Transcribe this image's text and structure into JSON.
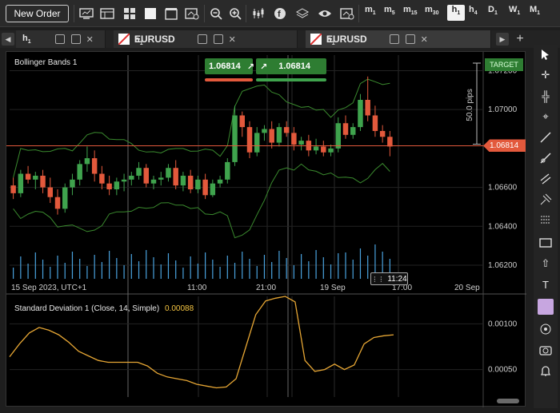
{
  "toolbar": {
    "new_order": "New Order",
    "timeframes": [
      {
        "base": "m",
        "sub": "1"
      },
      {
        "base": "m",
        "sub": "5"
      },
      {
        "base": "m",
        "sub": "15"
      },
      {
        "base": "m",
        "sub": "30"
      },
      {
        "base": "h",
        "sub": "1"
      },
      {
        "base": "h",
        "sub": "4"
      },
      {
        "base": "D",
        "sub": "1"
      },
      {
        "base": "W",
        "sub": "1"
      },
      {
        "base": "M",
        "sub": "1"
      }
    ],
    "active_timeframe": "h1"
  },
  "tabs": [
    {
      "timeframe_base": "h",
      "timeframe_sub": "1",
      "symbol": ""
    },
    {
      "timeframe_base": "",
      "timeframe_sub": "",
      "symbol": "EURUSD"
    },
    {
      "timeframe_base": "",
      "timeframe_sub": "",
      "symbol": "EURUSD"
    }
  ],
  "chart": {
    "main_title": "Bollinger Bands 1",
    "sell_price": "1.06814",
    "buy_price": "1.06814",
    "current_price": "1.06814",
    "target_label": "TARGET",
    "pips_label": "50.0 pips",
    "y_ticks": [
      "1.07200",
      "1.07000",
      "1.06600",
      "1.06400",
      "1.06200"
    ],
    "x_ticks": [
      "15 Sep 2023, UTC+1",
      "11:00",
      "21:00",
      "19 Sep",
      "17:00",
      "20 Sep"
    ],
    "crosshair_time": "11:24",
    "sub_title": "Standard Deviation 1 (Close, 14, Simple)",
    "sub_value": "0.00088",
    "sub_y_ticks": [
      "0.00100",
      "0.00050"
    ],
    "colors": {
      "bull": "#3fa34d",
      "bear": "#e3593c",
      "band": "#3a8a2e",
      "price_line": "#e3593c",
      "stddev": "#e6a634",
      "volume": "#4aa3df"
    }
  },
  "chart_data": [
    {
      "type": "candlestick",
      "title": "Bollinger Bands 1",
      "ylim": [
        1.0613,
        1.0728
      ],
      "y_ticks": [
        1.072,
        1.07,
        1.066,
        1.064,
        1.062
      ],
      "current_price": 1.06814,
      "series": [
        {
          "name": "candles",
          "ohlc": [
            [
              1.0661,
              1.0665,
              1.0654,
              1.0657
            ],
            [
              1.0657,
              1.0669,
              1.0655,
              1.0667
            ],
            [
              1.0667,
              1.0671,
              1.0662,
              1.0664
            ],
            [
              1.0664,
              1.0668,
              1.0659,
              1.0666
            ],
            [
              1.0666,
              1.0669,
              1.0657,
              1.066
            ],
            [
              1.066,
              1.0665,
              1.0652,
              1.0655
            ],
            [
              1.0655,
              1.0659,
              1.0646,
              1.0649
            ],
            [
              1.0649,
              1.0662,
              1.0647,
              1.066
            ],
            [
              1.066,
              1.0667,
              1.0656,
              1.0664
            ],
            [
              1.0664,
              1.0674,
              1.0661,
              1.0672
            ],
            [
              1.0672,
              1.0681,
              1.0668,
              1.0675
            ],
            [
              1.0675,
              1.0679,
              1.0663,
              1.0667
            ],
            [
              1.0667,
              1.0671,
              1.0659,
              1.0662
            ],
            [
              1.0662,
              1.0666,
              1.0656,
              1.0659
            ],
            [
              1.0659,
              1.0665,
              1.0656,
              1.0663
            ],
            [
              1.0663,
              1.0667,
              1.0658,
              1.0664
            ],
            [
              1.0664,
              1.0668,
              1.0661,
              1.0666
            ],
            [
              1.0666,
              1.0673,
              1.0664,
              1.067
            ],
            [
              1.067,
              1.0672,
              1.066,
              1.0662
            ],
            [
              1.0662,
              1.0666,
              1.0659,
              1.0664
            ],
            [
              1.0664,
              1.0668,
              1.0661,
              1.0665
            ],
            [
              1.0665,
              1.0672,
              1.0663,
              1.067
            ],
            [
              1.067,
              1.0674,
              1.0659,
              1.0661
            ],
            [
              1.0661,
              1.0668,
              1.0658,
              1.0666
            ],
            [
              1.0666,
              1.0669,
              1.0657,
              1.0659
            ],
            [
              1.0659,
              1.0666,
              1.0657,
              1.0664
            ],
            [
              1.0664,
              1.0667,
              1.0654,
              1.0656
            ],
            [
              1.0656,
              1.0664,
              1.0655,
              1.0662
            ],
            [
              1.0662,
              1.0666,
              1.066,
              1.0664
            ],
            [
              1.0664,
              1.0675,
              1.0662,
              1.0673
            ],
            [
              1.0673,
              1.0702,
              1.0671,
              1.0697
            ],
            [
              1.0697,
              1.0699,
              1.0686,
              1.0691
            ],
            [
              1.0691,
              1.0694,
              1.0675,
              1.0678
            ],
            [
              1.0678,
              1.0691,
              1.0676,
              1.0688
            ],
            [
              1.0688,
              1.0692,
              1.0684,
              1.069
            ],
            [
              1.069,
              1.0694,
              1.068,
              1.0683
            ],
            [
              1.0683,
              1.0693,
              1.0681,
              1.0691
            ],
            [
              1.0691,
              1.0694,
              1.0686,
              1.0688
            ],
            [
              1.0688,
              1.0691,
              1.0679,
              1.0682
            ],
            [
              1.0682,
              1.0686,
              1.0679,
              1.0684
            ],
            [
              1.0684,
              1.0687,
              1.0676,
              1.0679
            ],
            [
              1.0679,
              1.0685,
              1.0677,
              1.0681
            ],
            [
              1.0681,
              1.0684,
              1.0676,
              1.0678
            ],
            [
              1.0678,
              1.0682,
              1.0676,
              1.068
            ],
            [
              1.068,
              1.0696,
              1.0678,
              1.0693
            ],
            [
              1.0693,
              1.0697,
              1.0685,
              1.0687
            ],
            [
              1.0687,
              1.0693,
              1.0685,
              1.0691
            ],
            [
              1.0691,
              1.0708,
              1.0689,
              1.0705
            ],
            [
              1.0705,
              1.0717,
              1.0694,
              1.0697
            ],
            [
              1.0697,
              1.0702,
              1.0686,
              1.0689
            ],
            [
              1.0689,
              1.0692,
              1.0683,
              1.0686
            ],
            [
              1.0686,
              1.0689,
              1.0676,
              1.0681
            ]
          ]
        }
      ],
      "bands": {
        "upper_start": 1.0692,
        "upper_end": 1.0705,
        "lower_start": 1.0655,
        "lower_end": 1.0674
      },
      "x_ticks": [
        "15 Sep 2023, UTC+1",
        "11:00",
        "21:00",
        "19 Sep",
        "17:00",
        "20 Sep"
      ]
    },
    {
      "type": "line",
      "title": "Standard Deviation 1 (Close, 14, Simple)",
      "ylim": [
        0.0002,
        0.0013
      ],
      "y_ticks": [
        0.001,
        0.0005
      ],
      "series": [
        {
          "name": "Standard Deviation 1",
          "values": [
            0.00064,
            0.00078,
            0.0009,
            0.00096,
            0.00093,
            0.00088,
            0.0008,
            0.0007,
            0.00065,
            0.0006,
            0.00058,
            0.00058,
            0.00058,
            0.00058,
            0.00054,
            0.00046,
            0.00042,
            0.0004,
            0.00038,
            0.00034,
            0.00032,
            0.0003,
            0.00031,
            0.0004,
            0.00075,
            0.0011,
            0.00125,
            0.00128,
            0.0013,
            0.00124,
            0.0006,
            0.00048,
            0.0005,
            0.00056,
            0.0005,
            0.00055,
            0.00078,
            0.00085,
            0.00087,
            0.00088
          ]
        }
      ]
    }
  ]
}
